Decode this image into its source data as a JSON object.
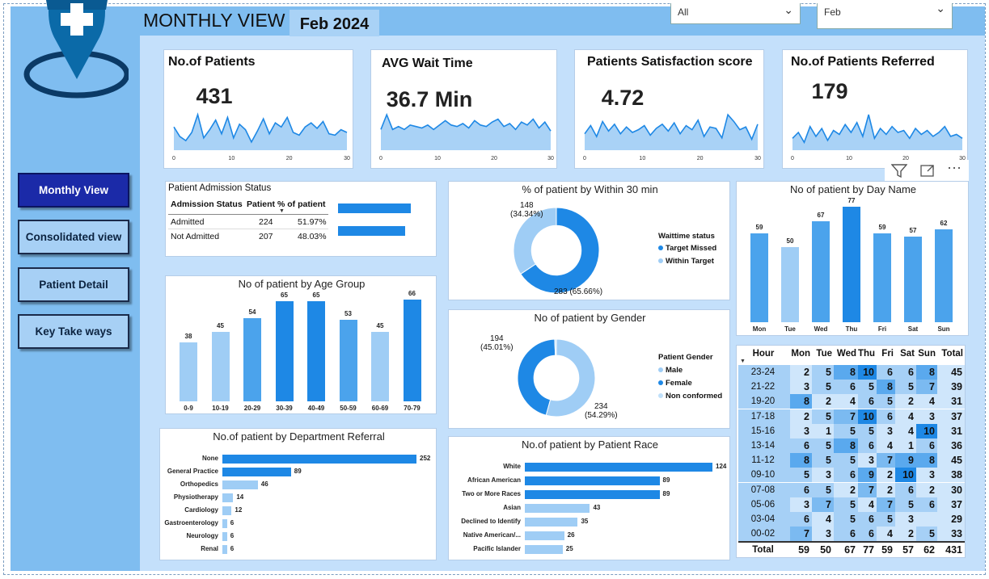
{
  "header": {
    "title": "MONTHLY VIEW",
    "period": "Feb 2024",
    "filter1": {
      "value": "All"
    },
    "filter2": {
      "value": "Feb"
    }
  },
  "sidebar": {
    "buttons": [
      {
        "label": "Monthly View",
        "active": true
      },
      {
        "label": "Consolidated view",
        "active": false
      },
      {
        "label": "Patient Detail",
        "active": false
      },
      {
        "label": "Key Take ways",
        "active": false
      }
    ]
  },
  "kpis": [
    {
      "title": "No.of Patients",
      "value": "431",
      "ticks": [
        "0",
        "10",
        "20",
        "30"
      ],
      "spark": [
        17,
        10,
        7,
        13,
        26,
        9,
        15,
        22,
        12,
        24,
        9,
        19,
        15,
        6,
        14,
        23,
        12,
        20,
        17,
        24,
        13,
        11,
        17,
        20,
        16,
        21,
        12,
        11,
        15,
        13
      ]
    },
    {
      "title": "AVG Wait Time",
      "value": "36.7 Min",
      "ticks": [
        "0",
        "10",
        "20",
        "30"
      ],
      "spark": [
        14,
        24,
        14,
        16,
        14,
        17,
        16,
        15,
        17,
        14,
        17,
        20,
        17,
        16,
        18,
        15,
        20,
        17,
        16,
        19,
        21,
        16,
        18,
        14,
        19,
        17,
        21,
        15,
        19,
        13
      ]
    },
    {
      "title": "Patients Satisfaction score",
      "value": "4.72",
      "ticks": [
        "0",
        "10",
        "20",
        "30"
      ],
      "spark": [
        12,
        18,
        10,
        21,
        14,
        19,
        12,
        17,
        13,
        15,
        18,
        11,
        16,
        19,
        14,
        20,
        12,
        18,
        15,
        22,
        10,
        17,
        16,
        9,
        26,
        21,
        15,
        17,
        8,
        19
      ]
    },
    {
      "title": "No.of Patients Referred",
      "value": "179",
      "ticks": [
        "0",
        "10",
        "20",
        "30"
      ],
      "spark": [
        6,
        9,
        4,
        12,
        7,
        11,
        5,
        10,
        8,
        13,
        9,
        14,
        7,
        18,
        6,
        11,
        8,
        12,
        9,
        10,
        6,
        11,
        8,
        10,
        7,
        9,
        12,
        7,
        8,
        6
      ]
    }
  ],
  "admission": {
    "title": "Patient Admission Status",
    "headers": [
      "Admission Status",
      "Patient",
      "% of patient"
    ],
    "rows": [
      {
        "status": "Admitted",
        "patient": "224",
        "pct": "51.97%",
        "frac": 0.5197
      },
      {
        "status": "Not Admitted",
        "patient": "207",
        "pct": "48.03%",
        "frac": 0.4803
      }
    ]
  },
  "visual_toolbar": {
    "filter_icon": "filter-icon",
    "focus_icon": "focus-mode-icon",
    "more_icon": "more-options-icon"
  },
  "chart_data": [
    {
      "id": "age",
      "type": "bar",
      "title": "No of patient by Age Group",
      "categories": [
        "0-9",
        "10-19",
        "20-29",
        "30-39",
        "40-49",
        "50-59",
        "60-69",
        "70-79"
      ],
      "values": [
        38,
        45,
        54,
        65,
        65,
        53,
        45,
        66
      ]
    },
    {
      "id": "dept",
      "type": "bar",
      "orientation": "horizontal",
      "title": "No.of patient by Department Referral",
      "categories": [
        "None",
        "General Practice",
        "Orthopedics",
        "Physiotherapy",
        "Cardiology",
        "Gastroenterology",
        "Neurology",
        "Renal"
      ],
      "values": [
        252,
        89,
        46,
        14,
        12,
        6,
        6,
        6
      ]
    },
    {
      "id": "wait",
      "type": "pie",
      "title": "% of patient by Within 30 min",
      "legend_title": "Waittime status",
      "labels": [
        "Target Missed",
        "Within Target"
      ],
      "values": [
        283,
        148
      ],
      "value_labels": [
        "283 (65.66%)",
        "148\n(34.34%)"
      ],
      "colors": [
        "#1e88e5",
        "#9fcdf5"
      ]
    },
    {
      "id": "gender",
      "type": "pie",
      "title": "No of patient by Gender",
      "legend_title": "Patient Gender",
      "labels": [
        "Male",
        "Female",
        "Non conformed"
      ],
      "values": [
        234,
        194,
        3
      ],
      "value_labels": [
        "234\n(54.29%)",
        "194\n(45.01%)"
      ],
      "colors": [
        "#9fcdf5",
        "#1e88e5",
        "#bfe0fa"
      ]
    },
    {
      "id": "race",
      "type": "bar",
      "orientation": "horizontal",
      "title": "No.of patient by Patient Race",
      "categories": [
        "White",
        "African American",
        "Two or More Races",
        "Asian",
        "Declined to Identify",
        "Native American/...",
        "Pacific Islander"
      ],
      "values": [
        124,
        89,
        89,
        43,
        35,
        26,
        25
      ]
    },
    {
      "id": "day",
      "type": "bar",
      "title": "No of patient by Day Name",
      "categories": [
        "Mon",
        "Tue",
        "Wed",
        "Thu",
        "Fri",
        "Sat",
        "Sun"
      ],
      "values": [
        59,
        50,
        67,
        77,
        59,
        57,
        62
      ]
    },
    {
      "id": "heat",
      "type": "heatmap",
      "columns": [
        "Hour",
        "Mon",
        "Tue",
        "Wed",
        "Thu",
        "Fri",
        "Sat",
        "Sun",
        "Total"
      ],
      "rows": [
        [
          "23-24",
          2,
          5,
          8,
          10,
          6,
          6,
          8,
          45
        ],
        [
          "21-22",
          3,
          5,
          6,
          5,
          8,
          5,
          7,
          39
        ],
        [
          "19-20",
          8,
          2,
          4,
          6,
          5,
          2,
          4,
          31
        ],
        [
          "17-18",
          2,
          5,
          7,
          10,
          6,
          4,
          3,
          37
        ],
        [
          "15-16",
          3,
          1,
          5,
          5,
          3,
          4,
          10,
          31
        ],
        [
          "13-14",
          6,
          5,
          8,
          6,
          4,
          1,
          6,
          36
        ],
        [
          "11-12",
          8,
          5,
          5,
          3,
          7,
          9,
          8,
          45
        ],
        [
          "09-10",
          5,
          3,
          6,
          9,
          2,
          10,
          3,
          38
        ],
        [
          "07-08",
          6,
          5,
          2,
          7,
          2,
          6,
          2,
          30
        ],
        [
          "05-06",
          3,
          7,
          5,
          4,
          7,
          5,
          6,
          37
        ],
        [
          "03-04",
          6,
          4,
          5,
          6,
          5,
          3,
          "",
          29
        ],
        [
          "00-02",
          7,
          3,
          6,
          6,
          4,
          2,
          5,
          33
        ]
      ],
      "totals": [
        "Total",
        59,
        50,
        67,
        77,
        59,
        57,
        62,
        431
      ]
    }
  ],
  "colors": {
    "sidebar": "#7fbdf0",
    "background": "#c4e0fb",
    "bar_dark": "#1e88e5",
    "bar_light": "#9fcdf5",
    "active_button": "#1b2aa8"
  }
}
